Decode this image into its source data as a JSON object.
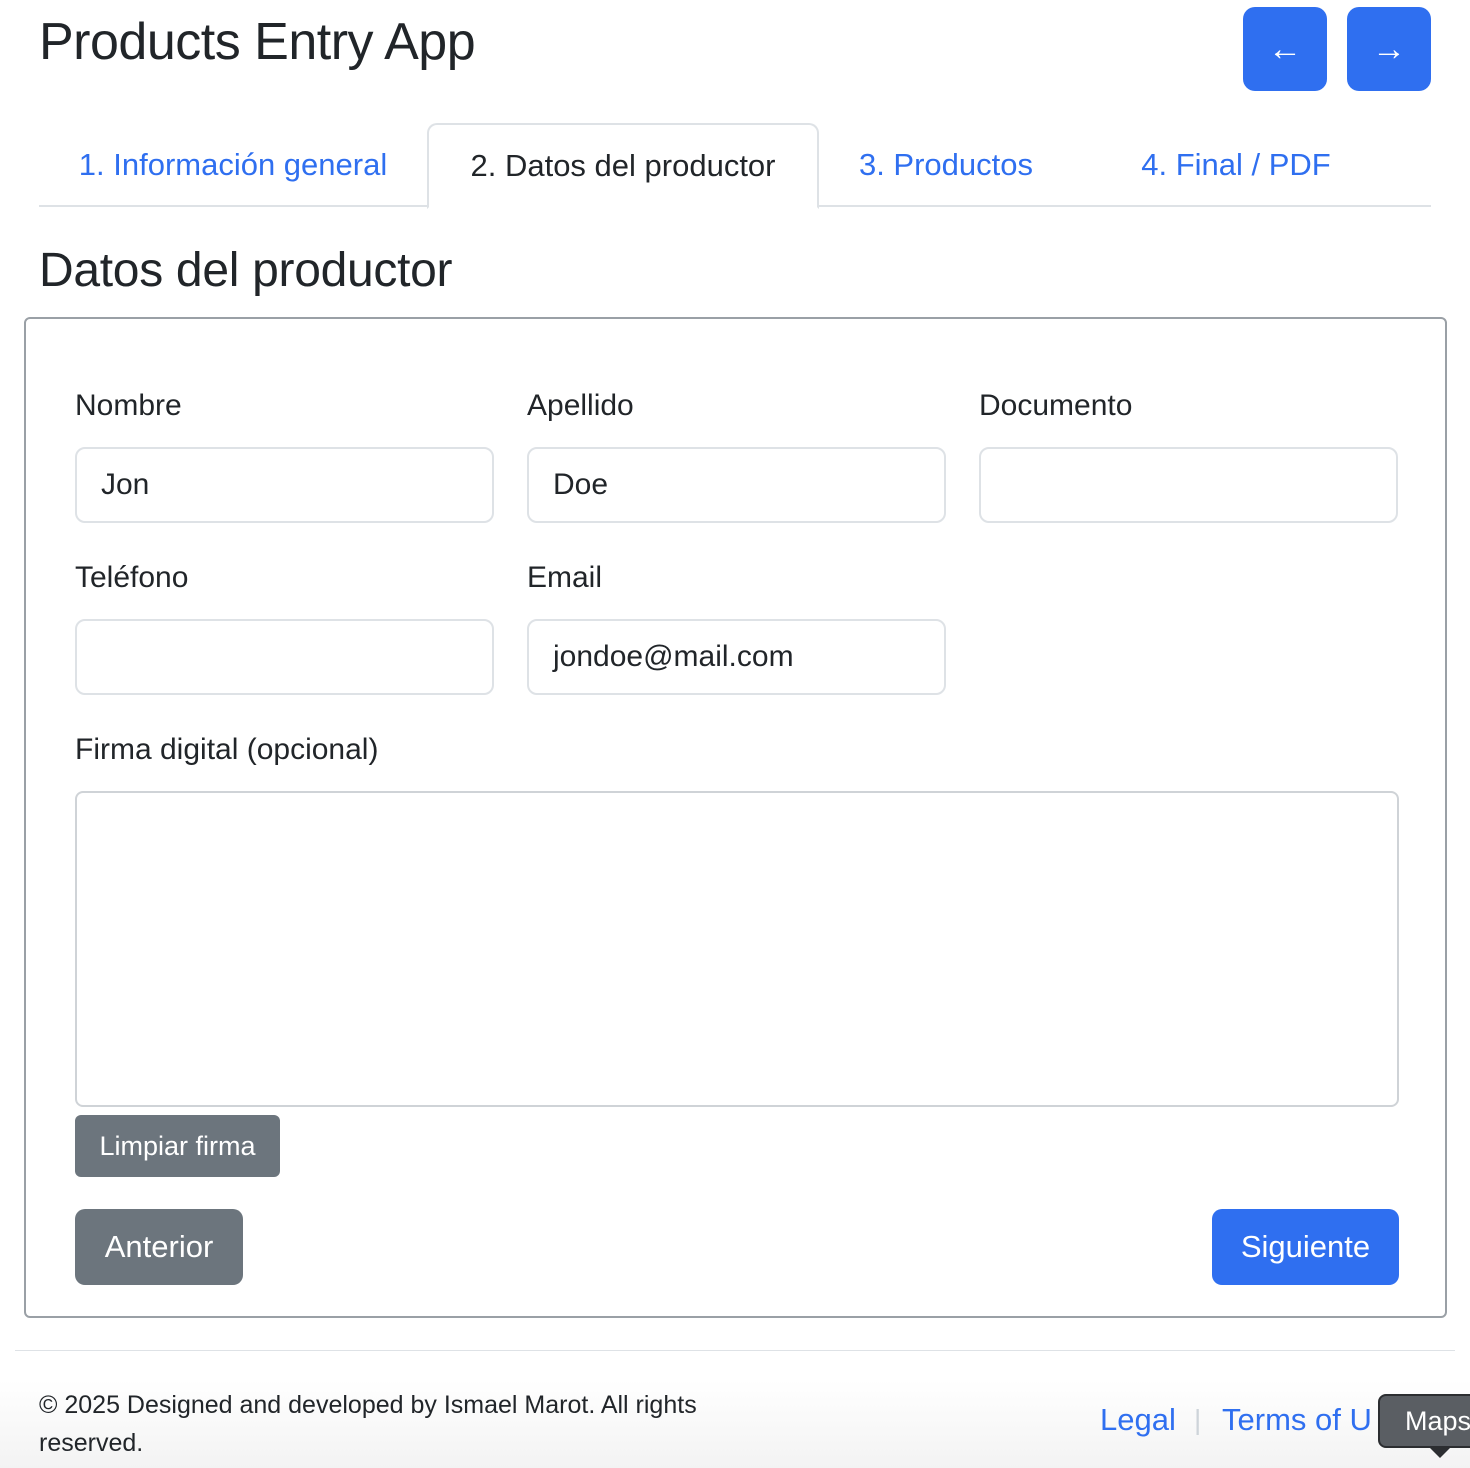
{
  "app": {
    "title": "Products Entry App",
    "prev_icon": "←",
    "next_icon": "→"
  },
  "tabs": [
    {
      "label": "1. Información general",
      "active": false
    },
    {
      "label": "2. Datos del productor",
      "active": true
    },
    {
      "label": "3. Productos",
      "active": false
    },
    {
      "label": "4. Final / PDF",
      "active": false
    }
  ],
  "section": {
    "title": "Datos del productor"
  },
  "form": {
    "nombre": {
      "label": "Nombre",
      "value": "Jon"
    },
    "apellido": {
      "label": "Apellido",
      "value": "Doe"
    },
    "documento": {
      "label": "Documento",
      "value": ""
    },
    "telefono": {
      "label": "Teléfono",
      "value": ""
    },
    "email": {
      "label": "Email",
      "value": "jondoe@mail.com"
    },
    "firma": {
      "label": "Firma digital (opcional)"
    },
    "clear_label": "Limpiar firma",
    "prev_label": "Anterior",
    "next_label": "Siguiente"
  },
  "footer": {
    "copyright": "© 2025 Designed and developed by Ismael Marot. All rights reserved.",
    "legal": "Legal",
    "separator": "|",
    "terms": "Terms of U",
    "maps_badge": "Maps"
  },
  "colors": {
    "primary": "#2f6ff0",
    "secondary": "#6c757d",
    "text": "#212529",
    "border": "#dee2e6"
  }
}
